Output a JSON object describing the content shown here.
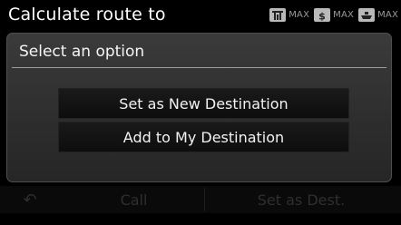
{
  "header": {
    "title": "Calculate route to",
    "route_preferences": [
      {
        "icon": "toll-road-icon",
        "label": "MAX"
      },
      {
        "icon": "dollar-icon",
        "label": "MAX"
      },
      {
        "icon": "ferry-icon",
        "label": "MAX"
      }
    ]
  },
  "dialog": {
    "title": "Select an option",
    "options": [
      {
        "label": "Set as New Destination"
      },
      {
        "label": "Add to My Destination"
      }
    ]
  },
  "bottom_bar": {
    "back_icon": "back-arrow-icon",
    "call_label": "Call",
    "set_dest_label": "Set as Dest."
  },
  "colors": {
    "background": "#000000",
    "dialog": "#333333",
    "button": "#111111",
    "text": "#ffffff",
    "dim_text": "#2f2f2f"
  }
}
